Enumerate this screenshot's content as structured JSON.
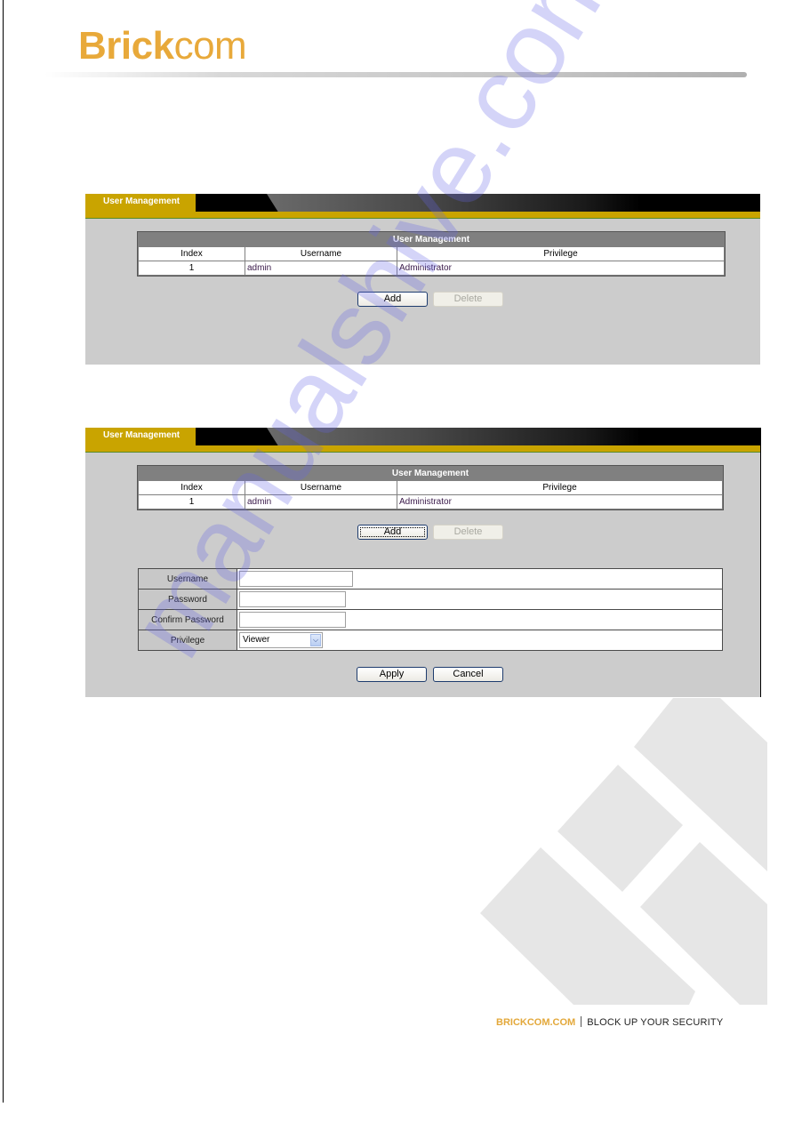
{
  "brand": {
    "logo_bold": "Brick",
    "logo_light": "com",
    "footer_site": "BRICKCOM.COM",
    "footer_tagline": "BLOCK UP YOUR SECURITY",
    "accent_color": "#e8a93a",
    "panel_accent_color": "#c9a400"
  },
  "watermark": "manualshive.com",
  "screen1": {
    "tab_label": "User Management",
    "table": {
      "caption": "User Management",
      "columns": [
        "Index",
        "Username",
        "Privilege"
      ],
      "rows": [
        {
          "index": "1",
          "username": "admin",
          "privilege": "Administrator"
        }
      ]
    },
    "buttons": {
      "add": "Add",
      "delete": "Delete"
    }
  },
  "screen2": {
    "tab_label": "User Management",
    "table": {
      "caption": "User Management",
      "columns": [
        "Index",
        "Username",
        "Privilege"
      ],
      "rows": [
        {
          "index": "1",
          "username": "admin",
          "privilege": "Administrator"
        }
      ]
    },
    "buttons": {
      "add": "Add",
      "delete": "Delete",
      "apply": "Apply",
      "cancel": "Cancel"
    },
    "form": {
      "username_label": "Username",
      "username_value": "",
      "password_label": "Password",
      "password_value": "",
      "confirm_label": "Confirm Password",
      "confirm_value": "",
      "privilege_label": "Privilege",
      "privilege_selected": "Viewer"
    }
  }
}
